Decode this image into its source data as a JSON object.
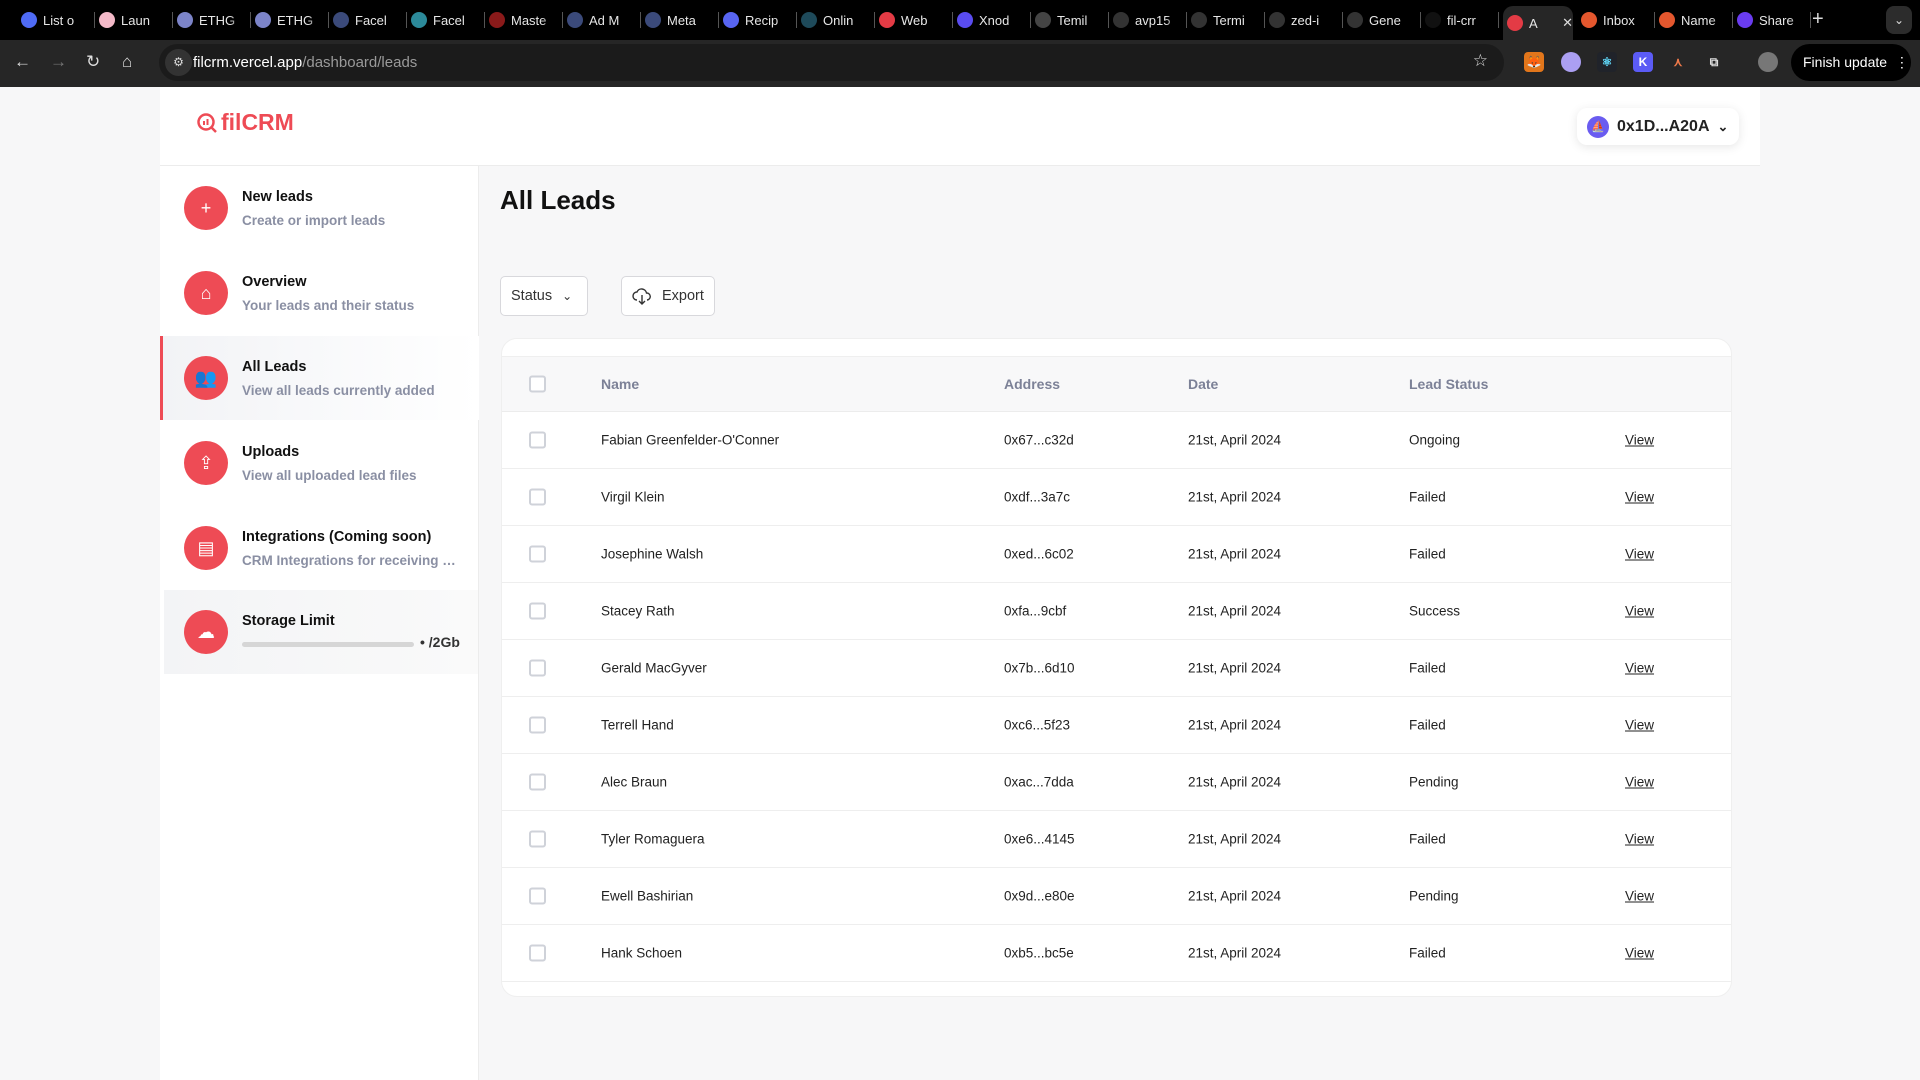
{
  "browser": {
    "tabs": [
      {
        "label": "List o",
        "color": "#4f6bf5"
      },
      {
        "label": "Laun",
        "color": "#f3b9c8"
      },
      {
        "label": "ETHG",
        "color": "#7c84c8"
      },
      {
        "label": "ETHG",
        "color": "#7c84c8"
      },
      {
        "label": "Facel",
        "color": "#3b4a7a"
      },
      {
        "label": "Facel",
        "color": "#2c8a9a"
      },
      {
        "label": "Maste",
        "color": "#8a1a1a"
      },
      {
        "label": "Ad M",
        "color": "#3b4a7a"
      },
      {
        "label": "Meta",
        "color": "#3b4a7a"
      },
      {
        "label": "Recip",
        "color": "#5865f2"
      },
      {
        "label": "Onlin",
        "color": "#1e4a5a"
      },
      {
        "label": "Web",
        "color": "#e33b45"
      },
      {
        "label": "Xnod",
        "color": "#5a4cf0"
      },
      {
        "label": "Temil",
        "color": "#444"
      },
      {
        "label": "avp15",
        "color": "#333"
      },
      {
        "label": "Termi",
        "color": "#333"
      },
      {
        "label": "zed-i",
        "color": "#333"
      },
      {
        "label": "Gene",
        "color": "#333"
      },
      {
        "label": "fil-crr",
        "color": "#111"
      },
      {
        "label": "A",
        "color": "#e33b45",
        "active": true
      },
      {
        "label": "Inbox",
        "color": "#e4572e"
      },
      {
        "label": "Name",
        "color": "#e4572e"
      },
      {
        "label": "Share",
        "color": "#6a3cf0"
      }
    ],
    "url_host": "filcrm.vercel.app",
    "url_path": "/dashboard/leads",
    "finish_update": "Finish update"
  },
  "header": {
    "logo": "filCRM",
    "wallet": "0x1D...A20A"
  },
  "sidebar": {
    "items": [
      {
        "title": "New leads",
        "subtitle": "Create or import leads",
        "icon": "plus-icon"
      },
      {
        "title": "Overview",
        "subtitle": "Your leads and their status",
        "icon": "home-icon"
      },
      {
        "title": "All Leads",
        "subtitle": "View all leads currently added",
        "icon": "users-icon",
        "active": true
      },
      {
        "title": "Uploads",
        "subtitle": "View all uploaded lead files",
        "icon": "cloud-upload-icon"
      },
      {
        "title": "Integrations (Coming soon)",
        "subtitle": "CRM Integrations for receiving leads",
        "icon": "integrations-icon"
      }
    ],
    "storage": {
      "title": "Storage Limit",
      "used_fraction": 0,
      "label": "• /2Gb"
    }
  },
  "main": {
    "title": "All Leads",
    "status_filter": "Status",
    "export": "Export",
    "columns": [
      "Name",
      "Address",
      "Date",
      "Lead Status"
    ],
    "rows": [
      {
        "name": "Fabian Greenfelder-O'Conner",
        "address": "0x67...c32d",
        "date": "21st, April 2024",
        "status": "Ongoing",
        "action": "View"
      },
      {
        "name": "Virgil Klein",
        "address": "0xdf...3a7c",
        "date": "21st, April 2024",
        "status": "Failed",
        "action": "View"
      },
      {
        "name": "Josephine Walsh",
        "address": "0xed...6c02",
        "date": "21st, April 2024",
        "status": "Failed",
        "action": "View"
      },
      {
        "name": "Stacey Rath",
        "address": "0xfa...9cbf",
        "date": "21st, April 2024",
        "status": "Success",
        "action": "View"
      },
      {
        "name": "Gerald MacGyver",
        "address": "0x7b...6d10",
        "date": "21st, April 2024",
        "status": "Failed",
        "action": "View"
      },
      {
        "name": "Terrell Hand",
        "address": "0xc6...5f23",
        "date": "21st, April 2024",
        "status": "Failed",
        "action": "View"
      },
      {
        "name": "Alec Braun",
        "address": "0xac...7dda",
        "date": "21st, April 2024",
        "status": "Pending",
        "action": "View"
      },
      {
        "name": "Tyler Romaguera",
        "address": "0xe6...4145",
        "date": "21st, April 2024",
        "status": "Failed",
        "action": "View"
      },
      {
        "name": "Ewell Bashirian",
        "address": "0x9d...e80e",
        "date": "21st, April 2024",
        "status": "Pending",
        "action": "View"
      },
      {
        "name": "Hank Schoen",
        "address": "0xb5...bc5e",
        "date": "21st, April 2024",
        "status": "Failed",
        "action": "View"
      }
    ]
  },
  "colors": {
    "accent": "#ee4b55"
  }
}
